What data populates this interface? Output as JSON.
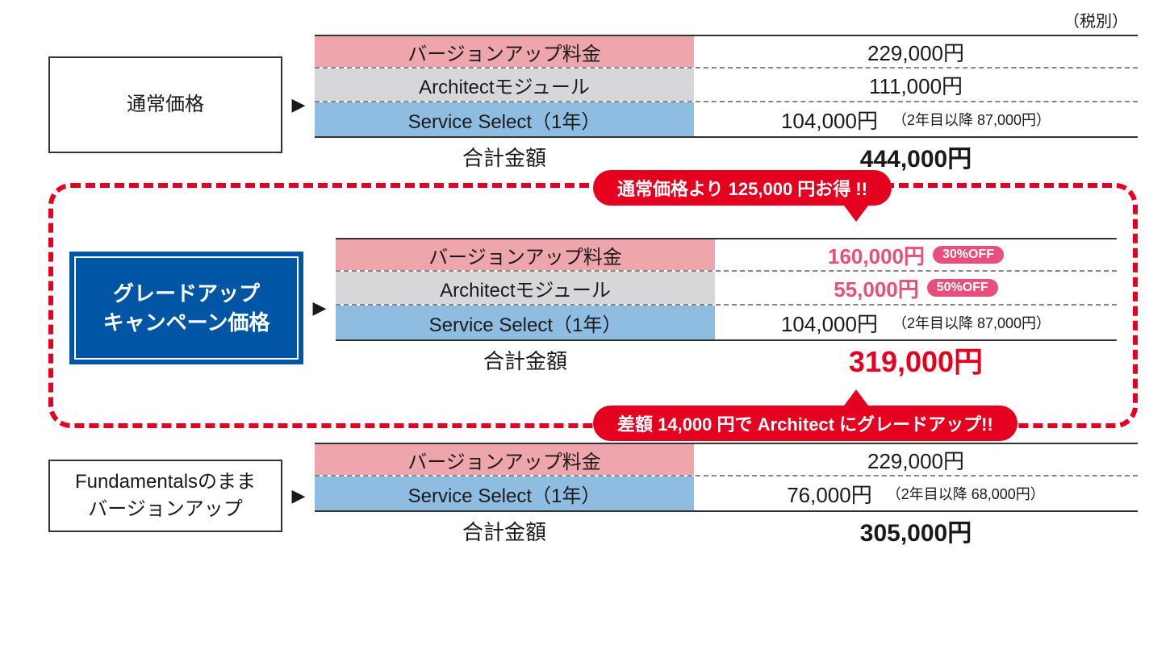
{
  "tax_note": "（税別）",
  "section1": {
    "label": "通常価格",
    "rows": [
      {
        "label": "バージョンアップ料金",
        "value": "229,000円"
      },
      {
        "label": "Architectモジュール",
        "value": "111,000円"
      },
      {
        "label": "Service Select（1年）",
        "value": "104,000円",
        "note": "（2年目以降 87,000円）"
      }
    ],
    "total_label": "合計金額",
    "total_value": "444,000円"
  },
  "campaign": {
    "label1": "グレードアップ",
    "label2": "キャンペーン価格",
    "pill_top": "通常価格より 125,000 円お得 !!",
    "pill_bottom": "差額 14,000 円で Architect にグレードアップ!!",
    "rows": [
      {
        "label": "バージョンアップ料金",
        "value": "160,000円",
        "badge": "30%OFF",
        "pink": true
      },
      {
        "label": "Architectモジュール",
        "value": "55,000円",
        "badge": "50%OFF",
        "pink": true
      },
      {
        "label": "Service Select（1年）",
        "value": "104,000円",
        "note": "（2年目以降 87,000円）"
      }
    ],
    "total_label": "合計金額",
    "total_value": "319,000円"
  },
  "section3": {
    "label1": "Fundamentalsのまま",
    "label2": "バージョンアップ",
    "rows": [
      {
        "label": "バージョンアップ料金",
        "value": "229,000円"
      },
      {
        "label": "Service Select（1年）",
        "value": "76,000円",
        "note": "（2年目以降 68,000円）"
      }
    ],
    "total_label": "合計金額",
    "total_value": "305,000円"
  },
  "chart_data": {
    "type": "table",
    "title": "グレードアップキャンペーン価格比較",
    "tax_note": "税別",
    "sections": [
      {
        "name": "通常価格",
        "items": [
          {
            "item": "バージョンアップ料金",
            "price_yen": 229000
          },
          {
            "item": "Architectモジュール",
            "price_yen": 111000
          },
          {
            "item": "Service Select（1年）",
            "price_yen": 104000,
            "from_year2_yen": 87000
          }
        ],
        "total_yen": 444000
      },
      {
        "name": "グレードアップキャンペーン価格",
        "savings_vs_regular_yen": 125000,
        "diff_to_architect_yen": 14000,
        "items": [
          {
            "item": "バージョンアップ料金",
            "price_yen": 160000,
            "discount_pct": 30
          },
          {
            "item": "Architectモジュール",
            "price_yen": 55000,
            "discount_pct": 50
          },
          {
            "item": "Service Select（1年）",
            "price_yen": 104000,
            "from_year2_yen": 87000
          }
        ],
        "total_yen": 319000
      },
      {
        "name": "Fundamentalsのままバージョンアップ",
        "items": [
          {
            "item": "バージョンアップ料金",
            "price_yen": 229000
          },
          {
            "item": "Service Select（1年）",
            "price_yen": 76000,
            "from_year2_yen": 68000
          }
        ],
        "total_yen": 305000
      }
    ]
  }
}
